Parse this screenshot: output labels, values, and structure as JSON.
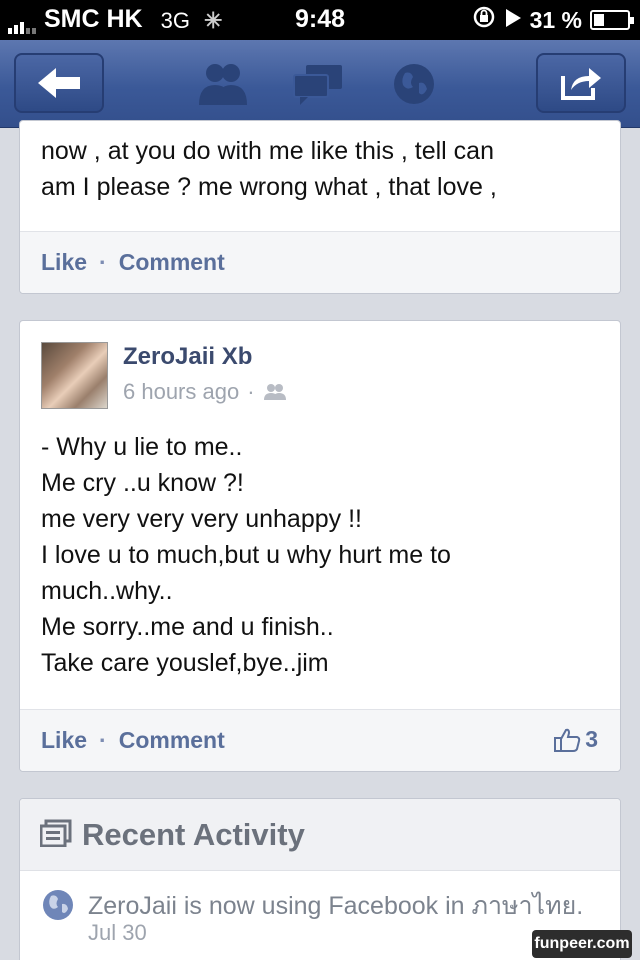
{
  "status_bar": {
    "carrier": "SMC HK",
    "network": "3G",
    "time": "9:48",
    "battery": "31 %",
    "battery_level": 0.31
  },
  "nav_bar": {
    "icons": [
      "back-arrow-icon",
      "friends-icon",
      "messages-icon",
      "notifications-globe-icon",
      "share-icon"
    ]
  },
  "post1": {
    "lines": [
      "now , at you do with me like this , tell can",
      "am I please ? me wrong what , that love ,"
    ],
    "like_label": "Like",
    "separator": "·",
    "comment_label": "Comment"
  },
  "post2": {
    "author": "ZeroJaii Xb",
    "time": "6 hours ago",
    "meta_separator": "·",
    "lines": [
      "- Why u lie to me..",
      "Me cry ..u know ?!",
      "me very very very unhappy !!",
      "I love u to much,but u why hurt me to",
      "much..why..",
      "Me sorry..me and u finish..",
      "Take care youslef,bye..jim"
    ],
    "like_label": "Like",
    "separator": "·",
    "comment_label": "Comment",
    "like_count": "3"
  },
  "recent_activity": {
    "title": "Recent Activity",
    "item_text": "ZeroJaii is now using Facebook in ภาษาไทย.",
    "item_date": "Jul 30"
  },
  "watermark": "funpeer.com",
  "colors": {
    "nav_blue": "#3b5998",
    "link_blue": "#5a6f9b"
  }
}
